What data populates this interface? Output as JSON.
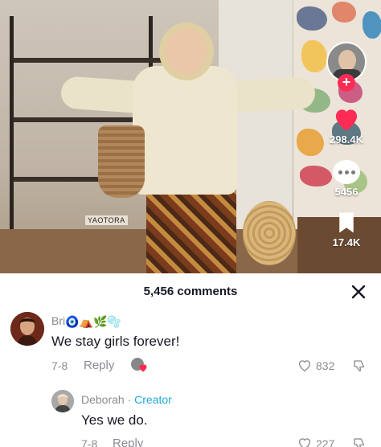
{
  "video": {
    "book_label": "YAOTORA",
    "likes": "298.4K",
    "comments": "5456",
    "saves": "17.4K"
  },
  "sheet": {
    "title": "5,456 comments"
  },
  "comments": [
    {
      "username": "Bri",
      "emojis": "🧿⛺🌿🫧",
      "text": "We stay girls forever!",
      "date": "7-8",
      "reply_label": "Reply",
      "likes": "832"
    },
    {
      "username": "Deborah",
      "separator": " · ",
      "tag": "Creator",
      "text": "Yes we do.",
      "date": "7-8",
      "reply_label": "Reply",
      "likes": "227"
    }
  ],
  "colors": {
    "like_heart": "#fe2c55",
    "creator_tag": "#20a9d8"
  }
}
